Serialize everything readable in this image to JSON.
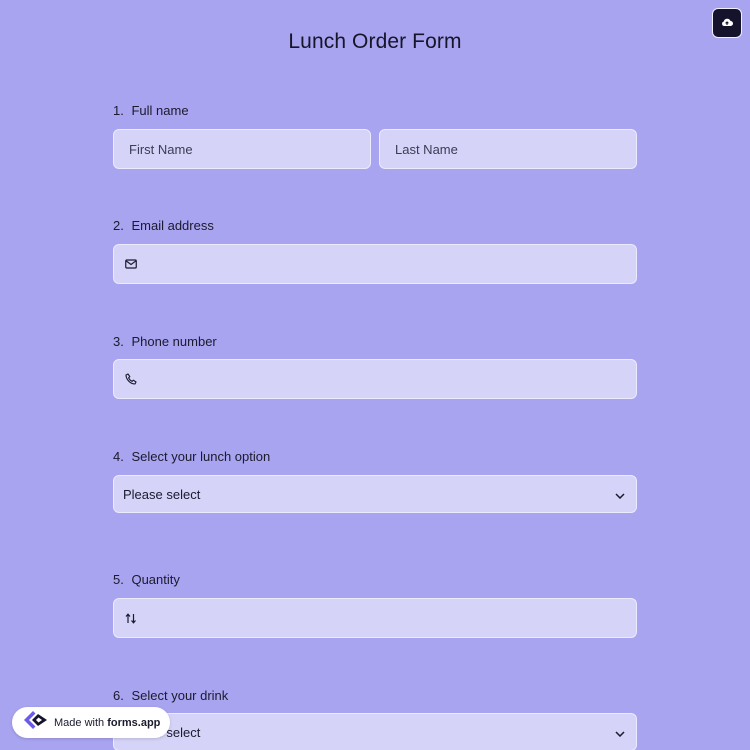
{
  "form": {
    "title": "Lunch Order Form"
  },
  "questions": [
    {
      "number": "1.",
      "label": "Full name"
    },
    {
      "number": "2.",
      "label": "Email address"
    },
    {
      "number": "3.",
      "label": "Phone number"
    },
    {
      "number": "4.",
      "label": "Select your lunch option"
    },
    {
      "number": "5.",
      "label": "Quantity"
    },
    {
      "number": "6.",
      "label": "Select your drink"
    }
  ],
  "fields": {
    "first_name_placeholder": "First Name",
    "last_name_placeholder": "Last Name",
    "lunch_select_value": "Please select",
    "drink_select_value": "Please select"
  },
  "icons": {
    "upload": "cloud-upload-icon",
    "email": "envelope-icon",
    "phone": "phone-icon",
    "quantity": "sort-arrows-icon",
    "select": "chevron-down-icon",
    "brand": "forms-app-logo"
  },
  "footer": {
    "made_with": "Made with",
    "brand": "forms.app"
  },
  "colors": {
    "background": "#a8a4f0",
    "field": "#d5d3f7",
    "dark": "#14132b"
  }
}
